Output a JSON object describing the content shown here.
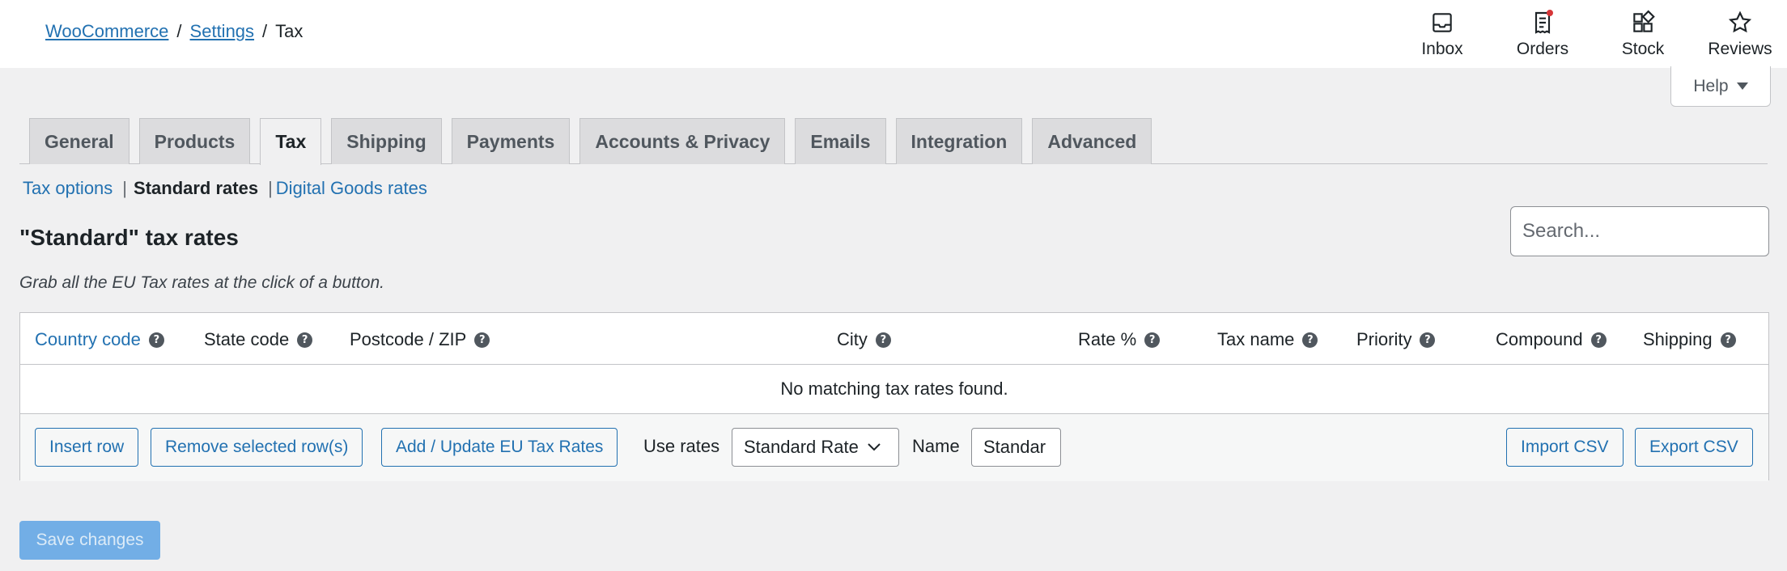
{
  "breadcrumb": {
    "root": "WooCommerce",
    "settings": "Settings",
    "separator": "/",
    "current": "Tax"
  },
  "activity_bar": [
    {
      "label": "Inbox",
      "icon": "inbox-icon"
    },
    {
      "label": "Orders",
      "icon": "orders-icon",
      "has_notification": true
    },
    {
      "label": "Stock",
      "icon": "stock-icon"
    },
    {
      "label": "Reviews",
      "icon": "reviews-icon"
    }
  ],
  "help": {
    "label": "Help"
  },
  "tabs": [
    "General",
    "Products",
    "Tax",
    "Shipping",
    "Payments",
    "Accounts & Privacy",
    "Emails",
    "Integration",
    "Advanced"
  ],
  "active_tab": "Tax",
  "subnav": {
    "tax_options": "Tax options",
    "standard_rates": "Standard rates",
    "digital_goods_rates": "Digital Goods rates",
    "separator": "|"
  },
  "page": {
    "title": "\"Standard\" tax rates",
    "description": "Grab all the EU Tax rates at the click of a button.",
    "search_placeholder": "Search..."
  },
  "table": {
    "columns": [
      "Country code",
      "State code",
      "Postcode / ZIP",
      "City",
      "Rate %",
      "Tax name",
      "Priority",
      "Compound",
      "Shipping"
    ],
    "empty_message": "No matching tax rates found."
  },
  "footer": {
    "insert_row": "Insert row",
    "remove_rows": "Remove selected row(s)",
    "add_update_eu": "Add / Update EU Tax Rates",
    "use_rates_label": "Use rates",
    "use_rates_value": "Standard Rate",
    "name_label": "Name",
    "name_value": "Standar",
    "import_csv": "Import CSV",
    "export_csv": "Export CSV"
  },
  "save": {
    "label": "Save changes"
  },
  "colors": {
    "link": "#2271b1",
    "primary_disabled": "#72aee6",
    "notification": "#d63638"
  }
}
